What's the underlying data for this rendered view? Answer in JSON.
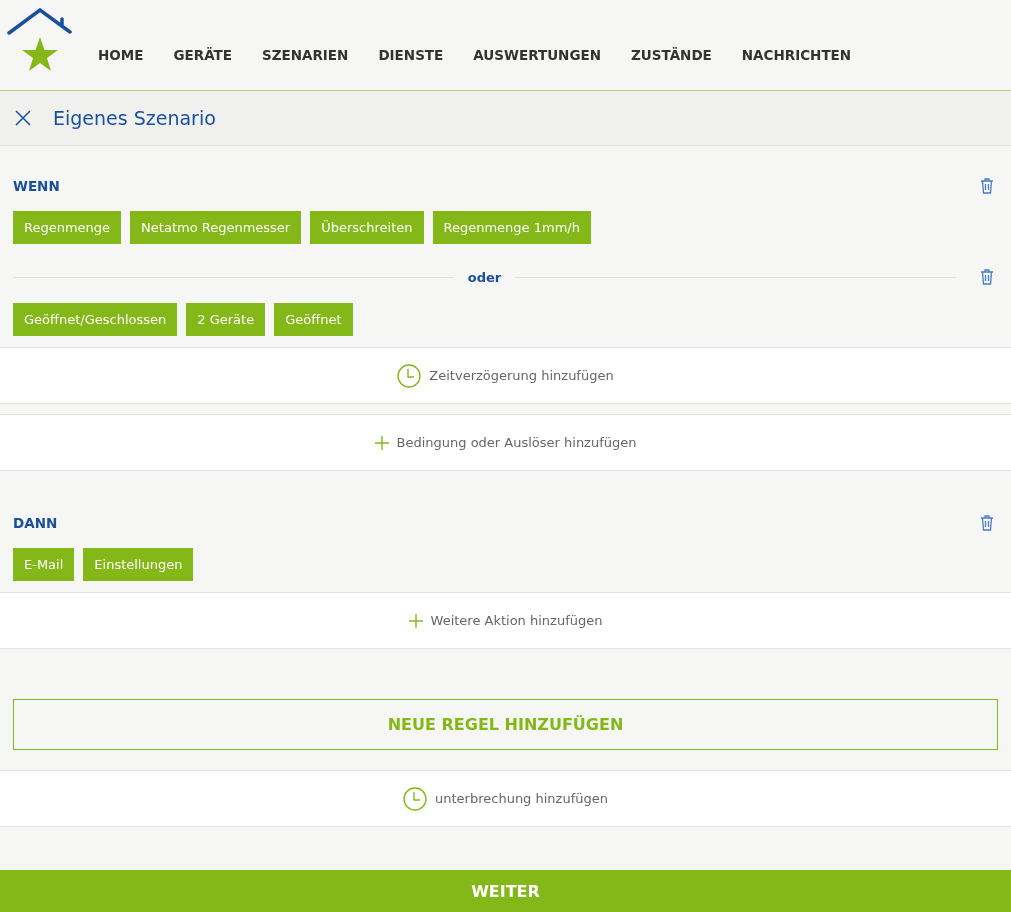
{
  "nav": [
    "HOME",
    "GERÄTE",
    "SZENARIEN",
    "DIENSTE",
    "AUSWERTUNGEN",
    "ZUSTÄNDE",
    "NACHRICHTEN"
  ],
  "title": "Eigenes Szenario",
  "blocks": [
    {
      "kind": "section",
      "label": "WENN",
      "groups": [
        {
          "chips": [
            "Regenmenge",
            "Netatmo Regenmesser",
            "Überschreiten",
            "Regenmenge 1mm/h"
          ]
        },
        {
          "separator": "oder",
          "chips": [
            "Geöffnet/Geschlossen",
            "2 Geräte",
            "Geöffnet"
          ]
        }
      ]
    },
    {
      "kind": "timed-action",
      "label": "Zeitverzögerung hinzufügen"
    },
    {
      "kind": "add-action",
      "label": "Bedingung oder Auslöser hinzufügen"
    },
    {
      "kind": "section",
      "label": "DANN",
      "groups": [
        {
          "chips": [
            "E-Mail",
            "Einstellungen"
          ]
        }
      ]
    },
    {
      "kind": "add-action",
      "label": "Weitere Aktion hinzufügen"
    },
    {
      "kind": "outline-button",
      "label": "NEUE REGEL HINZUFÜGEN"
    },
    {
      "kind": "timed-action",
      "label": "unterbrechung hinzufügen"
    }
  ],
  "next_button": "WEITER"
}
